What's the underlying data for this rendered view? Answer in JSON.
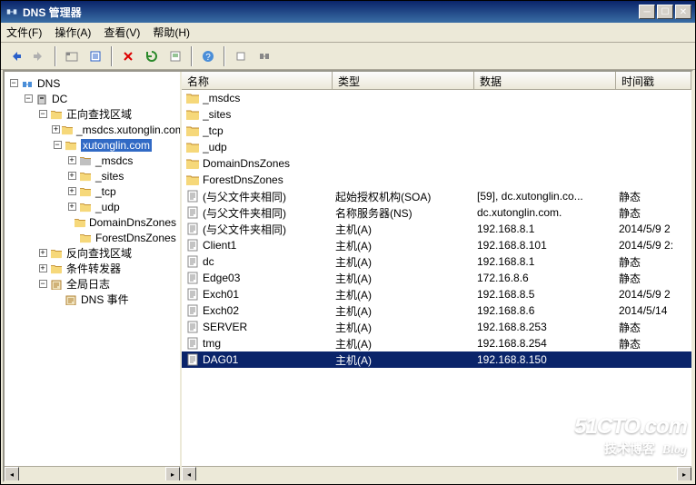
{
  "window": {
    "title": "DNS 管理器"
  },
  "menubar": [
    {
      "label": "文件(F)"
    },
    {
      "label": "操作(A)"
    },
    {
      "label": "查看(V)"
    },
    {
      "label": "帮助(H)"
    }
  ],
  "tree": [
    {
      "indent": 0,
      "exp": "-",
      "icon": "app",
      "label": "DNS",
      "sel": false
    },
    {
      "indent": 1,
      "exp": "-",
      "icon": "server",
      "label": "DC",
      "sel": false
    },
    {
      "indent": 2,
      "exp": "-",
      "icon": "folder",
      "label": "正向查找区域",
      "sel": false
    },
    {
      "indent": 3,
      "exp": "+",
      "icon": "zone",
      "label": "_msdcs.xutonglin.com",
      "sel": false
    },
    {
      "indent": 3,
      "exp": "-",
      "icon": "zone",
      "label": "xutonglin.com",
      "sel": true
    },
    {
      "indent": 4,
      "exp": "+",
      "icon": "folder-g",
      "label": "_msdcs",
      "sel": false
    },
    {
      "indent": 4,
      "exp": "+",
      "icon": "folder",
      "label": "_sites",
      "sel": false
    },
    {
      "indent": 4,
      "exp": "+",
      "icon": "folder",
      "label": "_tcp",
      "sel": false
    },
    {
      "indent": 4,
      "exp": "+",
      "icon": "folder",
      "label": "_udp",
      "sel": false
    },
    {
      "indent": 4,
      "exp": "",
      "icon": "folder",
      "label": "DomainDnsZones",
      "sel": false
    },
    {
      "indent": 4,
      "exp": "",
      "icon": "folder",
      "label": "ForestDnsZones",
      "sel": false
    },
    {
      "indent": 2,
      "exp": "+",
      "icon": "folder",
      "label": "反向查找区域",
      "sel": false
    },
    {
      "indent": 2,
      "exp": "+",
      "icon": "folder",
      "label": "条件转发器",
      "sel": false
    },
    {
      "indent": 2,
      "exp": "-",
      "icon": "log",
      "label": "全局日志",
      "sel": false
    },
    {
      "indent": 3,
      "exp": "",
      "icon": "log",
      "label": "DNS 事件",
      "sel": false
    }
  ],
  "columns": {
    "name": "名称",
    "type": "类型",
    "data": "数据",
    "ts": "时间戳"
  },
  "rows": [
    {
      "icon": "folder",
      "name": "_msdcs",
      "type": "",
      "data": "",
      "ts": "",
      "sel": false
    },
    {
      "icon": "folder",
      "name": "_sites",
      "type": "",
      "data": "",
      "ts": "",
      "sel": false
    },
    {
      "icon": "folder",
      "name": "_tcp",
      "type": "",
      "data": "",
      "ts": "",
      "sel": false
    },
    {
      "icon": "folder",
      "name": "_udp",
      "type": "",
      "data": "",
      "ts": "",
      "sel": false
    },
    {
      "icon": "folder",
      "name": "DomainDnsZones",
      "type": "",
      "data": "",
      "ts": "",
      "sel": false
    },
    {
      "icon": "folder",
      "name": "ForestDnsZones",
      "type": "",
      "data": "",
      "ts": "",
      "sel": false
    },
    {
      "icon": "rec",
      "name": "(与父文件夹相同)",
      "type": "起始授权机构(SOA)",
      "data": "[59], dc.xutonglin.co...",
      "ts": "静态",
      "sel": false
    },
    {
      "icon": "rec",
      "name": "(与父文件夹相同)",
      "type": "名称服务器(NS)",
      "data": "dc.xutonglin.com.",
      "ts": "静态",
      "sel": false
    },
    {
      "icon": "rec",
      "name": "(与父文件夹相同)",
      "type": "主机(A)",
      "data": "192.168.8.1",
      "ts": "2014/5/9 2",
      "sel": false
    },
    {
      "icon": "rec",
      "name": "Client1",
      "type": "主机(A)",
      "data": "192.168.8.101",
      "ts": "2014/5/9 2:",
      "sel": false
    },
    {
      "icon": "rec",
      "name": "dc",
      "type": "主机(A)",
      "data": "192.168.8.1",
      "ts": "静态",
      "sel": false
    },
    {
      "icon": "rec",
      "name": "Edge03",
      "type": "主机(A)",
      "data": "172.16.8.6",
      "ts": "静态",
      "sel": false
    },
    {
      "icon": "rec",
      "name": "Exch01",
      "type": "主机(A)",
      "data": "192.168.8.5",
      "ts": "2014/5/9 2",
      "sel": false
    },
    {
      "icon": "rec",
      "name": "Exch02",
      "type": "主机(A)",
      "data": "192.168.8.6",
      "ts": "2014/5/14 ",
      "sel": false
    },
    {
      "icon": "rec",
      "name": "SERVER",
      "type": "主机(A)",
      "data": "192.168.8.253",
      "ts": "静态",
      "sel": false
    },
    {
      "icon": "rec",
      "name": "tmg",
      "type": "主机(A)",
      "data": "192.168.8.254",
      "ts": "静态",
      "sel": false
    },
    {
      "icon": "rec",
      "name": "DAG01",
      "type": "主机(A)",
      "data": "192.168.8.150",
      "ts": "",
      "sel": true
    }
  ],
  "watermark": {
    "line1": "51CTO.com",
    "line2": "技术博客",
    "line3": "Blog"
  }
}
